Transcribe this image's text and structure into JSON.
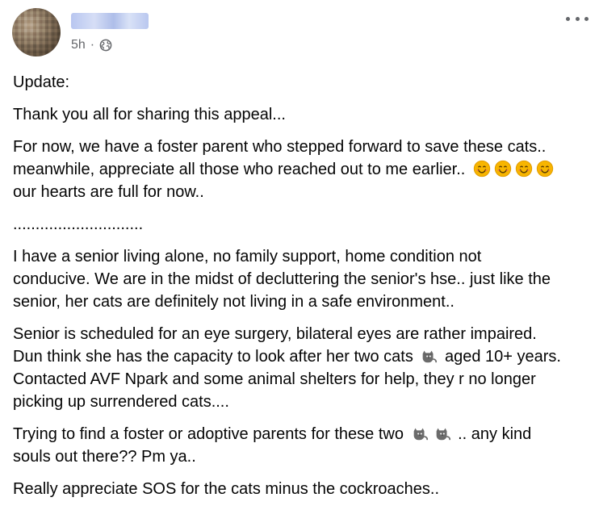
{
  "post": {
    "author": "author",
    "time": "5h",
    "separator": "·",
    "icons": {
      "audience": "globe-icon",
      "more": "more-options-icon",
      "smile": "smiling-face-emoji",
      "cat": "cat-emoji"
    }
  },
  "text": {
    "update": "Update:",
    "thanks": "Thank you all for sharing this appeal...",
    "foster_1": "For now, we have a foster parent who stepped forward to save these cats..",
    "foster_2": "meanwhile, appreciate all those who reached out to me earlier..",
    "foster_3": "our hearts are full for now..",
    "divider": ".............................",
    "senior_1": "I have a senior living alone, no family support, home condition not",
    "senior_2": "conducive. We are in the midst of decluttering the senior's hse.. just like the",
    "senior_3": "senior, her cats are definitely not living in a safe environment..",
    "surgery_1": "Senior is scheduled for an eye surgery, bilateral eyes are rather impaired.",
    "surgery_2a": "Dun think she has the capacity to look after her two cats",
    "surgery_2b": "aged 10+ years.",
    "surgery_3": "Contacted AVF Npark and some animal shelters for help, they r no longer",
    "surgery_4": "picking up surrendered cats....",
    "foster_find_1a": "Trying to find a foster or adoptive parents for these two",
    "foster_find_1b": ".. any kind",
    "foster_find_2": "souls out there?? Pm ya..",
    "sos": "Really appreciate SOS for the cats minus the cockroaches.."
  }
}
